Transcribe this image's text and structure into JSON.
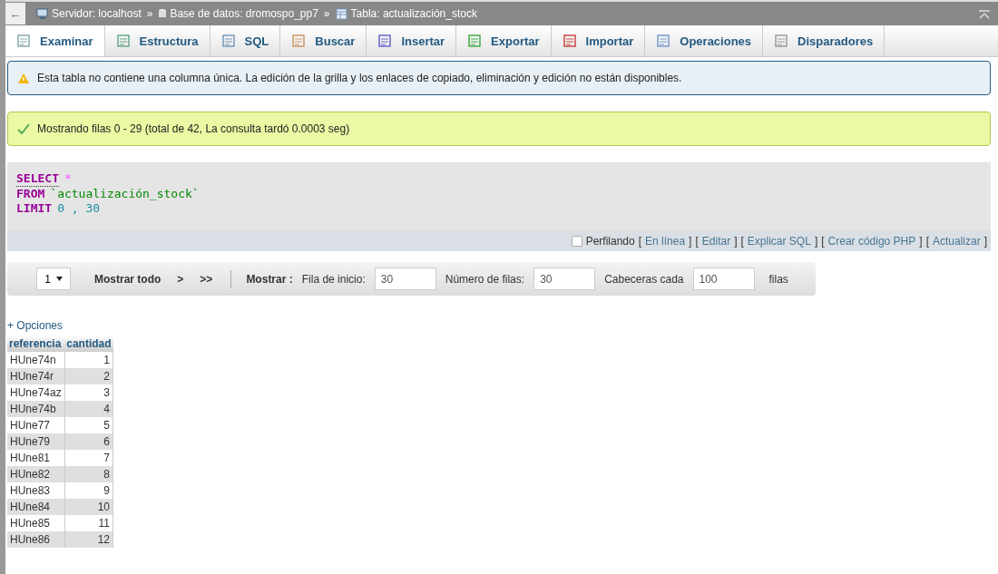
{
  "topbar": {
    "back": "←",
    "separator": "»",
    "crumbs": [
      {
        "kind": "server",
        "label": "Servidor: localhost"
      },
      {
        "kind": "database",
        "label": "Base de datos: dromospo_pp7"
      },
      {
        "kind": "table",
        "label": "Tabla: actualización_stock"
      }
    ]
  },
  "tabs": [
    {
      "kind": "browse",
      "label": "Examinar",
      "selected": true
    },
    {
      "kind": "structure",
      "label": "Estructura",
      "selected": false
    },
    {
      "kind": "sql",
      "label": "SQL",
      "selected": false
    },
    {
      "kind": "search",
      "label": "Buscar",
      "selected": false
    },
    {
      "kind": "insert",
      "label": "Insertar",
      "selected": false
    },
    {
      "kind": "export",
      "label": "Exportar",
      "selected": false
    },
    {
      "kind": "import",
      "label": "Importar",
      "selected": false
    },
    {
      "kind": "operations",
      "label": "Operaciones",
      "selected": false
    },
    {
      "kind": "triggers",
      "label": "Disparadores",
      "selected": false
    }
  ],
  "notice": {
    "text": "Esta tabla no contiene una columna única. La edición de la grilla y los enlaces de copiado, eliminación y edición no están disponibles."
  },
  "success": {
    "text": "Mostrando filas 0 - 29 (total de 42, La consulta tardó 0.0003 seg)"
  },
  "sql": {
    "lines": [
      [
        {
          "kind": "keyword",
          "text": "SELECT"
        },
        {
          "kind": "operator",
          "text": "*"
        }
      ],
      [
        {
          "kind": "keyword",
          "text": "FROM"
        },
        {
          "kind": "string",
          "text": "`actualización_stock`"
        }
      ],
      [
        {
          "kind": "keyword",
          "text": "LIMIT"
        },
        {
          "kind": "number",
          "text": "0 , 30"
        }
      ]
    ],
    "profiling": {
      "label": "Perfilando",
      "checked": false
    },
    "bracket_open": "[",
    "bracket_close": "]",
    "links": [
      "En línea",
      "Editar",
      "Explicar SQL",
      "Crear código PHP",
      "Actualizar"
    ]
  },
  "navigation": {
    "page": "1",
    "show_all": "Mostrar todo",
    "next": ">",
    "last": ">>",
    "show_label": "Mostrar :",
    "start_label": "Fila de inicio:",
    "start_value": "30",
    "rows_label": "Número de filas:",
    "rows_value": "30",
    "headers_label": "Cabeceras cada",
    "headers_value": "100",
    "rows_suffix": "filas"
  },
  "options_link": "+ Opciones",
  "table": {
    "columns": [
      "referencia",
      "cantidad"
    ],
    "rows": [
      [
        "HUne74n",
        "1"
      ],
      [
        "HUne74r",
        "2"
      ],
      [
        "HUne74az",
        "3"
      ],
      [
        "HUne74b",
        "4"
      ],
      [
        "HUne77",
        "5"
      ],
      [
        "HUne79",
        "6"
      ],
      [
        "HUne81",
        "7"
      ],
      [
        "HUne82",
        "8"
      ],
      [
        "HUne83",
        "9"
      ],
      [
        "HUne84",
        "10"
      ],
      [
        "HUne85",
        "11"
      ],
      [
        "HUne86",
        "12"
      ]
    ]
  }
}
